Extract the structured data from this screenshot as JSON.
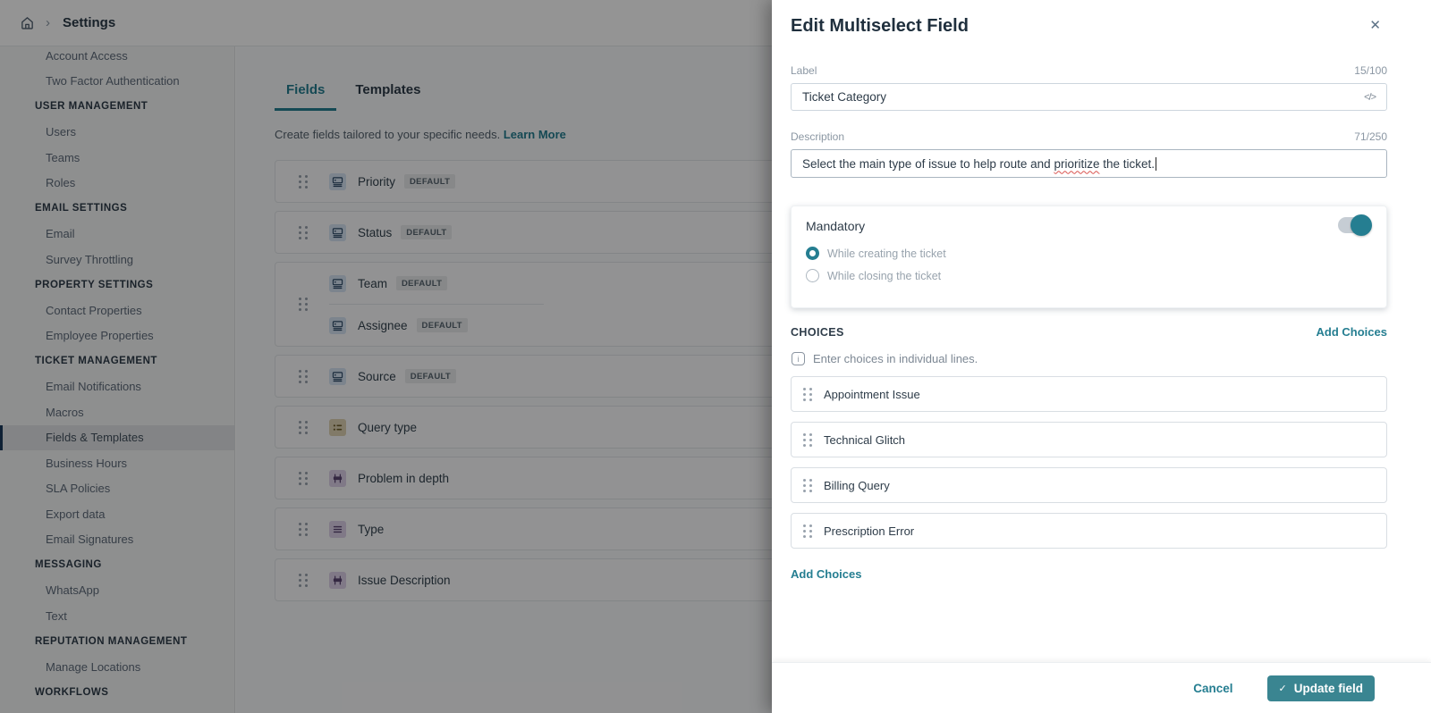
{
  "colors": {
    "accent": "#257e91",
    "button": "#3a8591"
  },
  "topbar": {
    "breadcrumb_separator": "›",
    "title": "Settings"
  },
  "sidebar": {
    "items": [
      {
        "label": "Account Access",
        "type": "item"
      },
      {
        "label": "Two Factor Authentication",
        "type": "item"
      },
      {
        "label": "USER MANAGEMENT",
        "type": "section"
      },
      {
        "label": "Users",
        "type": "item"
      },
      {
        "label": "Teams",
        "type": "item"
      },
      {
        "label": "Roles",
        "type": "item"
      },
      {
        "label": "EMAIL SETTINGS",
        "type": "section"
      },
      {
        "label": "Email",
        "type": "item"
      },
      {
        "label": "Survey Throttling",
        "type": "item"
      },
      {
        "label": "PROPERTY SETTINGS",
        "type": "section"
      },
      {
        "label": "Contact Properties",
        "type": "item"
      },
      {
        "label": "Employee Properties",
        "type": "item"
      },
      {
        "label": "TICKET MANAGEMENT",
        "type": "section"
      },
      {
        "label": "Email Notifications",
        "type": "item"
      },
      {
        "label": "Macros",
        "type": "item"
      },
      {
        "label": "Fields & Templates",
        "type": "item",
        "selected": true
      },
      {
        "label": "Business Hours",
        "type": "item"
      },
      {
        "label": "SLA Policies",
        "type": "item"
      },
      {
        "label": "Export data",
        "type": "item"
      },
      {
        "label": "Email Signatures",
        "type": "item"
      },
      {
        "label": "MESSAGING",
        "type": "section"
      },
      {
        "label": "WhatsApp",
        "type": "item"
      },
      {
        "label": "Text",
        "type": "item"
      },
      {
        "label": "REPUTATION MANAGEMENT",
        "type": "section"
      },
      {
        "label": "Manage Locations",
        "type": "item"
      },
      {
        "label": "WORKFLOWS",
        "type": "section"
      }
    ]
  },
  "content": {
    "tabs": [
      {
        "label": "Fields",
        "active": true
      },
      {
        "label": "Templates",
        "active": false
      }
    ],
    "subtitle": "Create fields tailored to your specific needs.",
    "learn_more_label": "Learn More",
    "field_groups": [
      {
        "rows": [
          {
            "label": "Priority",
            "badge": "DEFAULT",
            "icon": "select-icon",
            "style": "blue"
          }
        ]
      },
      {
        "rows": [
          {
            "label": "Status",
            "badge": "DEFAULT",
            "icon": "select-icon",
            "style": "blue"
          }
        ]
      },
      {
        "rows": [
          {
            "label": "Team",
            "badge": "DEFAULT",
            "icon": "select-icon",
            "style": "blue"
          },
          {
            "label": "Assignee",
            "badge": "DEFAULT",
            "icon": "select-icon",
            "style": "blue"
          }
        ]
      },
      {
        "rows": [
          {
            "label": "Source",
            "badge": "DEFAULT",
            "icon": "select-icon",
            "style": "blue"
          }
        ]
      },
      {
        "rows": [
          {
            "label": "Query type",
            "badge": "",
            "icon": "bullet-list-icon",
            "style": "tan"
          }
        ]
      },
      {
        "rows": [
          {
            "label": "Problem in depth",
            "badge": "",
            "icon": "paragraph-icon",
            "style": "purple"
          }
        ]
      },
      {
        "rows": [
          {
            "label": "Type",
            "badge": "",
            "icon": "list-icon",
            "style": "purple"
          }
        ]
      },
      {
        "rows": [
          {
            "label": "Issue Description",
            "badge": "",
            "icon": "paragraph-icon",
            "style": "purple"
          }
        ]
      }
    ]
  },
  "drawer": {
    "title": "Edit Multiselect Field",
    "close_icon": "✕",
    "label_field": {
      "label": "Label",
      "counter": "15/100",
      "value": "Ticket Category",
      "code_icon": "</>"
    },
    "description_field": {
      "label": "Description",
      "counter": "71/250",
      "text_before": "Select the main type of issue to help route and ",
      "text_misspelled": "prioritize",
      "text_after": " the ticket."
    },
    "mandatory": {
      "label": "Mandatory",
      "toggle_on": true,
      "options": [
        {
          "label": "While creating the ticket",
          "selected": true
        },
        {
          "label": "While closing the ticket",
          "selected": false
        }
      ]
    },
    "choices": {
      "heading": "CHOICES",
      "add_link_top": "Add Choices",
      "hint": "Enter choices in individual lines.",
      "info_icon": "i",
      "items": [
        "Appointment Issue",
        "Technical Glitch",
        "Billing Query",
        "Prescription Error"
      ],
      "add_link_bottom": "Add Choices"
    },
    "footer": {
      "cancel_label": "Cancel",
      "update_check": "✓",
      "update_label": "Update field"
    }
  }
}
